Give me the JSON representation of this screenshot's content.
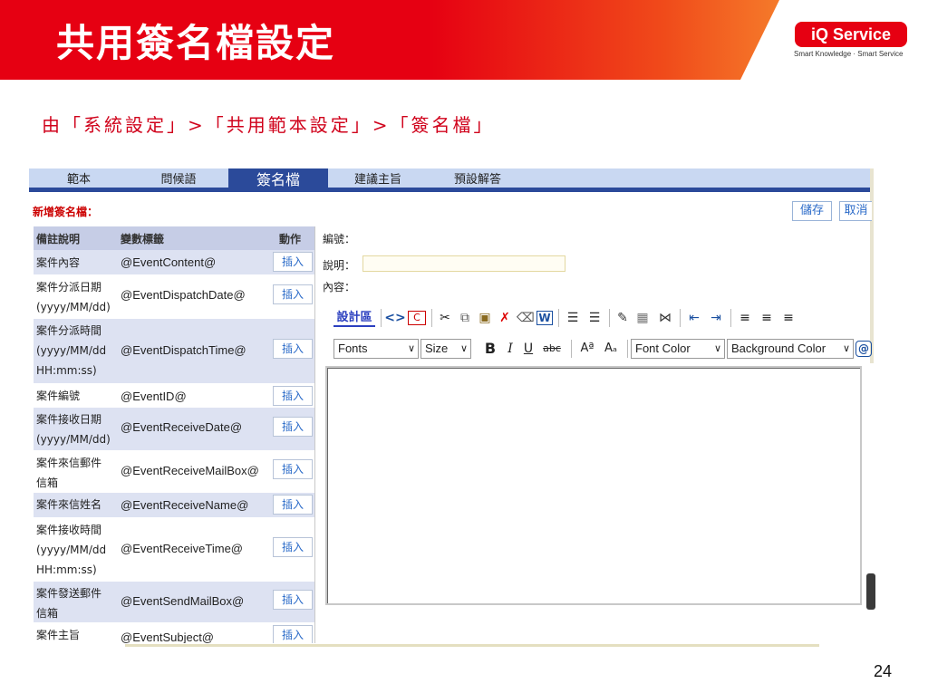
{
  "slide": {
    "title": "共用簽名檔設定",
    "breadcrumb": "由「系統設定」>「共用範本設定」>「簽名檔」",
    "logo_text": "iQ Service",
    "logo_tagline": "Smart Knowledge · Smart Service",
    "page_number": "24",
    "brand_color": "#e60012"
  },
  "tabs": [
    {
      "label": "範本"
    },
    {
      "label": "問候語"
    },
    {
      "label": "簽名檔",
      "active": true
    },
    {
      "label": "建議主旨"
    },
    {
      "label": "預設解答"
    }
  ],
  "form": {
    "section_label": "新增簽名檔：",
    "save_label": "儲存",
    "cancel_label": "取消",
    "id_label": "編號：",
    "desc_label": "說明：",
    "content_label": "內容：",
    "desc_value": ""
  },
  "table": {
    "headers": {
      "desc": "備註說明",
      "var": "變數標籤",
      "action": "動作"
    },
    "insert_label": "插入",
    "rows": [
      {
        "desc": "案件內容",
        "var": "@EventContent@"
      },
      {
        "desc": "案件分派日期\n(yyyy/MM/dd)",
        "var": "@EventDispatchDate@"
      },
      {
        "desc": "案件分派時間\n(yyyy/MM/dd\nHH:mm:ss)",
        "var": "@EventDispatchTime@"
      },
      {
        "desc": "案件編號",
        "var": "@EventID@"
      },
      {
        "desc": "案件接收日期\n(yyyy/MM/dd)",
        "var": "@EventReceiveDate@"
      },
      {
        "desc": "案件來信郵件\n信箱",
        "var": "@EventReceiveMailBox@"
      },
      {
        "desc": "案件來信姓名",
        "var": "@EventReceiveName@"
      },
      {
        "desc": "案件接收時間\n(yyyy/MM/dd\nHH:mm:ss)",
        "var": "@EventReceiveTime@"
      },
      {
        "desc": "案件發送郵件\n信箱",
        "var": "@EventSendMailBox@"
      },
      {
        "desc": "案件主旨",
        "var": "@EventSubject@"
      }
    ]
  },
  "editor": {
    "design_label": "設計區",
    "fonts_select": "Fonts",
    "size_select": "Size",
    "font_color_select": "Font Color",
    "bg_color_select": "Background Color",
    "bold": "B",
    "italic": "I",
    "underline": "U",
    "strike": "abc",
    "superscript": "Aª",
    "subscript": "Aₐ",
    "icons": [
      "source-code-icon",
      "copy-icon",
      "cut-icon",
      "paste-icon",
      "paste-word-icon",
      "delete-icon",
      "eraser-icon",
      "word-icon",
      "ordered-list-icon",
      "unordered-list-icon",
      "pen-icon",
      "table-icon",
      "horizontal-rule-icon",
      "outdent-icon",
      "indent-icon",
      "align-left-icon",
      "align-center-icon",
      "align-right-icon"
    ]
  }
}
